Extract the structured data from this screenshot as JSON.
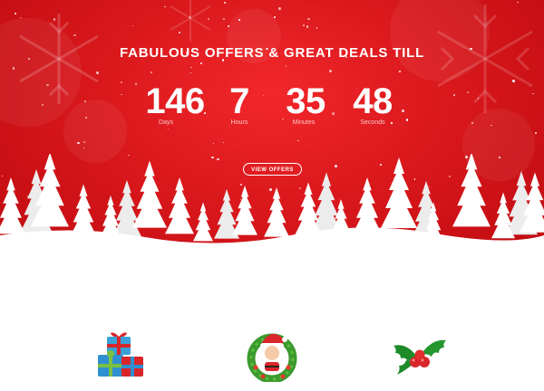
{
  "hero": {
    "headline": "FABULOUS OFFERS & GREAT DEALS TILL",
    "countdown": [
      {
        "value": "146",
        "label": "Days"
      },
      {
        "value": "7",
        "label": "Hours"
      },
      {
        "value": "35",
        "label": "Minutes"
      },
      {
        "value": "48",
        "label": "Seconds"
      }
    ],
    "button_label": "VIEW OFFERS"
  },
  "features": {
    "icons": [
      "gift-boxes-icon",
      "santa-wreath-icon",
      "holly-icon"
    ]
  },
  "colors": {
    "hero_red": "#d9181c",
    "snow": "#ffffff",
    "tree_shadow": "#f0f0f0"
  }
}
